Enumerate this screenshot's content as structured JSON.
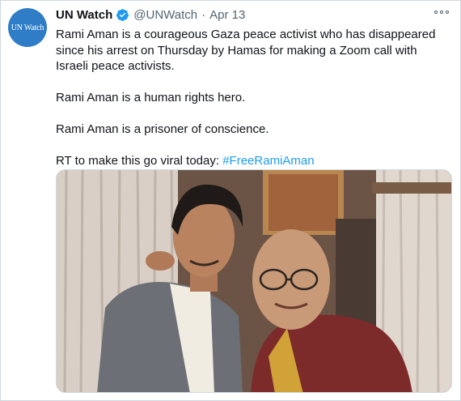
{
  "account": {
    "avatar_text": "UN Watch",
    "name": "UN Watch",
    "handle": "@UNWatch",
    "separator": "·",
    "date": "Apr 13"
  },
  "tweet": {
    "paragraph1": "Rami Aman is a courageous Gaza peace activist who has disappeared since his arrest on Thursday by Hamas for making a Zoom call with Israeli peace activists.",
    "paragraph2": "Rami Aman is a human rights hero.",
    "paragraph3": "Rami Aman is a prisoner of conscience.",
    "paragraph4_prefix": "RT to make this go viral today: ",
    "hashtag": "#FreeRamiAman"
  },
  "colors": {
    "accent": "#1d9bf0",
    "avatar_bg": "#2f7dc6",
    "muted": "#536471"
  },
  "icons": {
    "verified": "verified-badge-icon",
    "more": "more-options-icon"
  }
}
